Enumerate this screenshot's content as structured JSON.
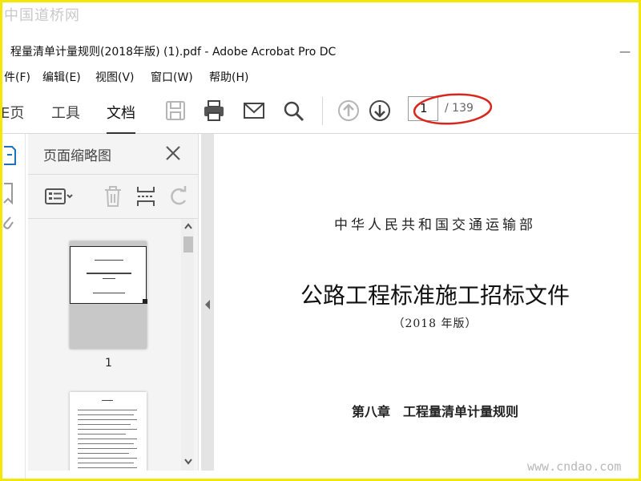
{
  "watermark": {
    "top": "中国道桥网",
    "bottom": "www.cndao.com"
  },
  "window": {
    "title": "程量清单计量规则(2018年版) (1).pdf - Adobe Acrobat Pro DC",
    "minimize": "—"
  },
  "menu": [
    "件(F)",
    "编辑(E)",
    "视图(V)",
    "窗口(W)",
    "帮助(H)"
  ],
  "toolbar": {
    "tabs": [
      "E页",
      "工具",
      "文档"
    ],
    "active_tab": "文档",
    "icons": [
      "save-icon",
      "print-icon",
      "email-icon",
      "search-icon",
      "page-up-icon",
      "page-down-icon"
    ],
    "page_current": "1",
    "page_total": "/ 139",
    "highlight_color": "#d9261c"
  },
  "panel": {
    "title": "页面缩略图",
    "tools": [
      "thumbnail-options-icon",
      "delete-icon",
      "insert-page-icon",
      "rotate-icon"
    ],
    "thumbnails": [
      {
        "label": "1"
      }
    ]
  },
  "document": {
    "ministry": "中华人民共和国交通运输部",
    "title": "公路工程标准施工招标文件",
    "year": "（2018 年版）",
    "chapter": "第八章　工程量清单计量规则"
  }
}
